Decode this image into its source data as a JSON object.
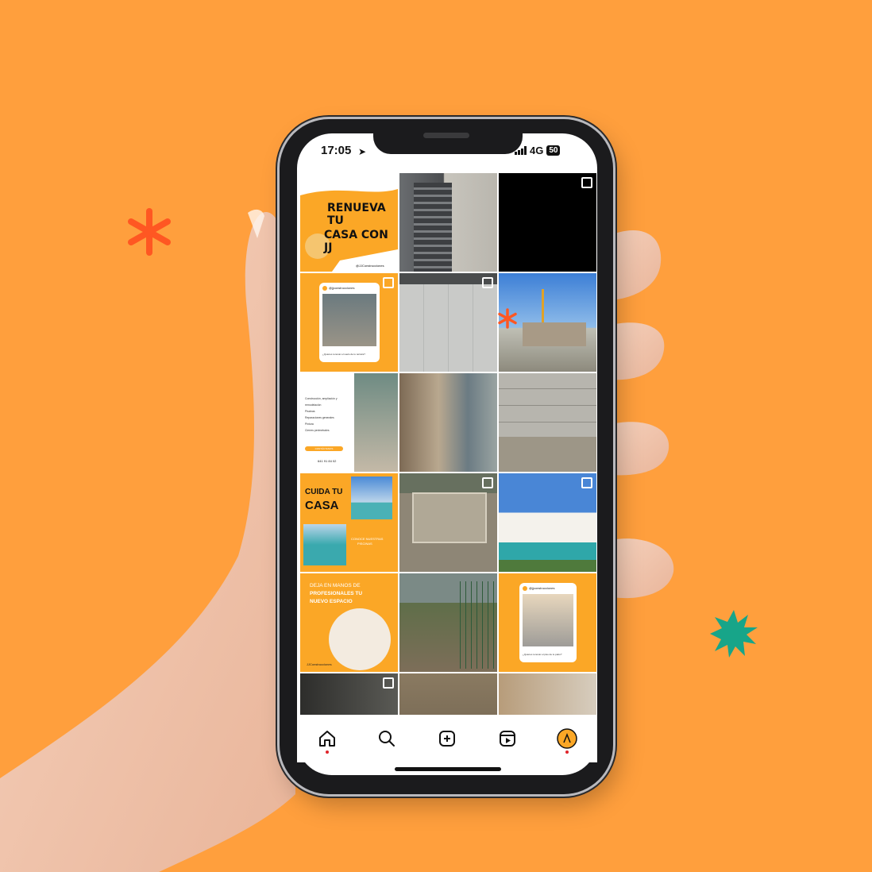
{
  "status_bar": {
    "time": "17:05",
    "network": "4G",
    "battery": "50"
  },
  "tiles": [
    {
      "id": "renueva",
      "lines": [
        "RENUEVA TU",
        "CASA CON JJ"
      ],
      "handle": "@JJConstrucciones"
    },
    {
      "id": "post-ig-1",
      "handle": "@jjconstrucciones",
      "caption": "¿Quieres renovar el suelo de tu terraza?"
    },
    {
      "id": "services",
      "items": [
        "Construcción, ampliación y remodelación",
        "Piscinas",
        "Reparaciones generales",
        "Pintura",
        "Cierres perimetrales"
      ],
      "button": "CONTÁCTANOS",
      "phone": "641 91 84 02"
    },
    {
      "id": "cuida",
      "lines": [
        "CUIDA TU",
        "CASA"
      ],
      "sub": [
        "CONOCE NUESTRAS",
        "PISCINAS"
      ]
    },
    {
      "id": "profesionales",
      "lines": [
        "DEJA EN MANOS DE",
        "PROFESIONALES TU",
        "NUEVO ESPACIO"
      ],
      "handle": "JJConstrucciones"
    },
    {
      "id": "post-ig-2",
      "handle": "@jjconstrucciones",
      "caption": "¿Quieres renovar el piso de tu patio?"
    }
  ],
  "nav": [
    {
      "name": "home-icon",
      "dot": true
    },
    {
      "name": "search-icon",
      "dot": false
    },
    {
      "name": "create-icon",
      "dot": false
    },
    {
      "name": "reels-icon",
      "dot": false
    },
    {
      "name": "profile-avatar",
      "dot": true
    }
  ],
  "colors": {
    "background": "#FF9F3D",
    "brand": "#FBA726",
    "asterisk": "#FF5722",
    "star": "#17A589"
  }
}
